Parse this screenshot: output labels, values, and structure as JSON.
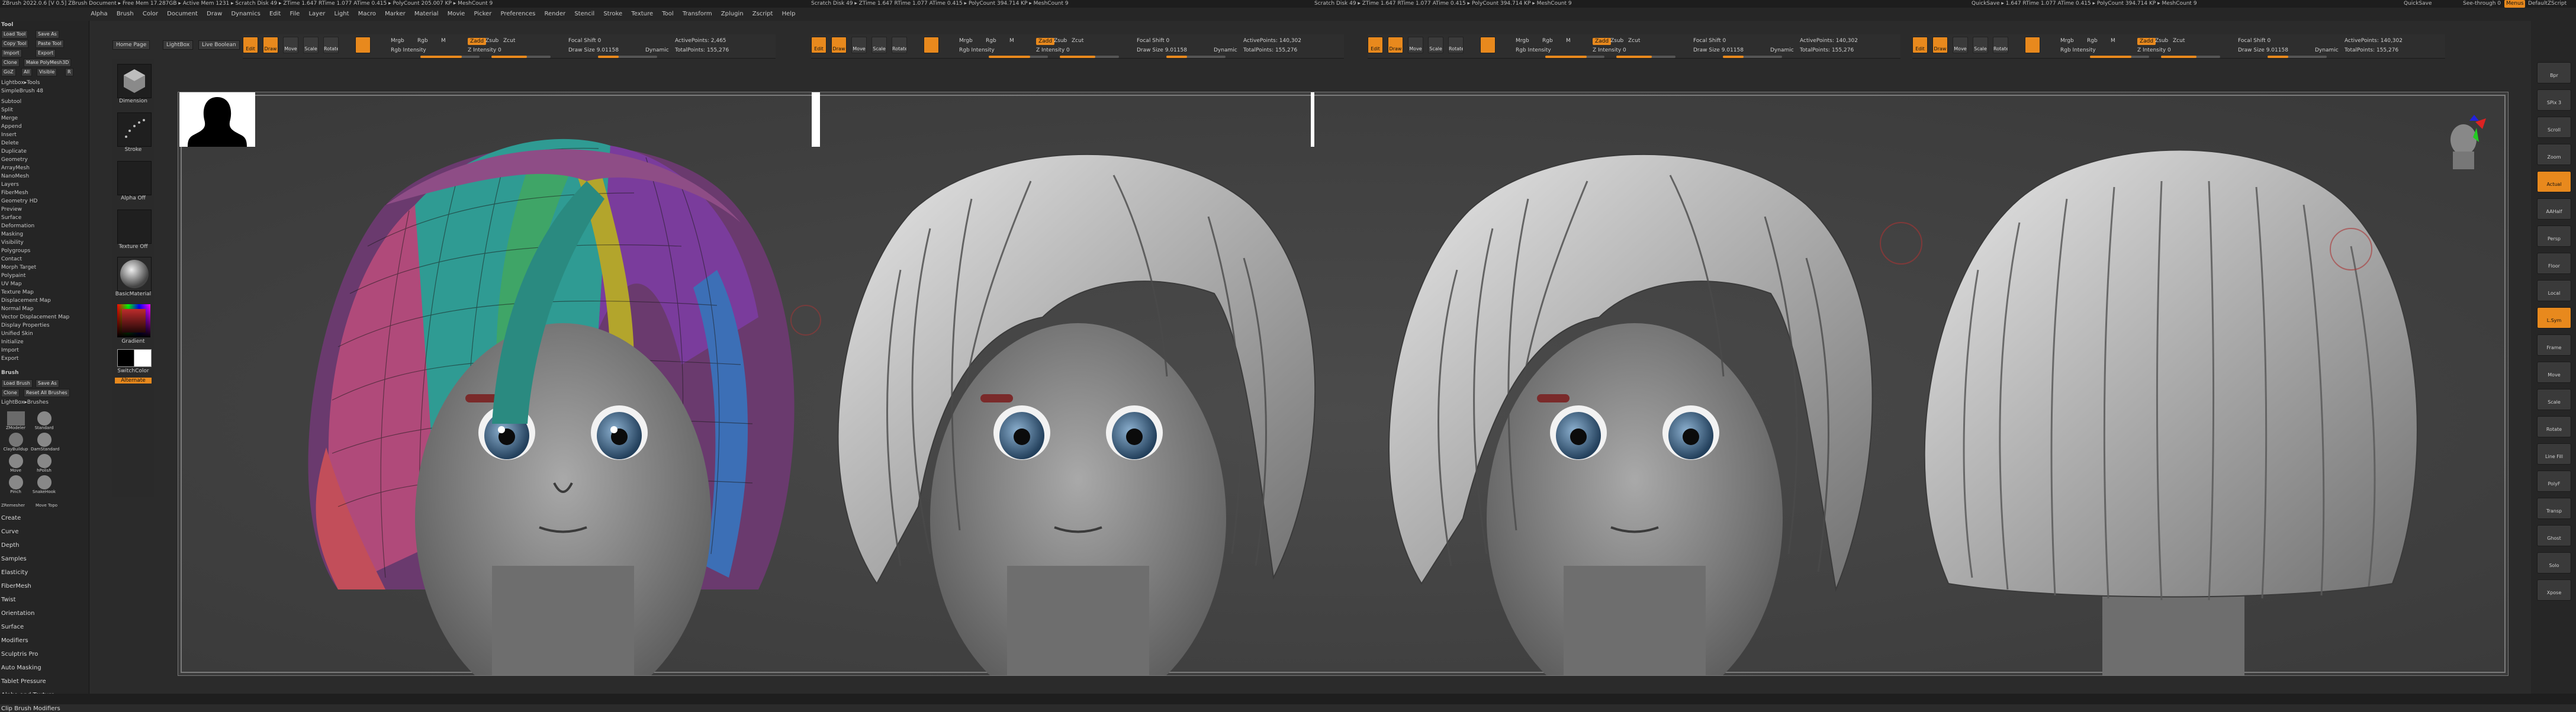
{
  "app": {
    "title_segments": [
      "ZBrush 2022.0.6 [V 0.5]   ZBrush Document   ▸ Free Mem 17.287GB ▸ Active Mem 1231 ▸ Scratch Disk 49 ▸ ZTime 1.647 RTime 1.077 ATime 0.415 ▸ PolyCount 205.007 KP ▸ MeshCount 9",
      "Scratch Disk 49 ▸ ZTime 1.647 RTime 1.077 ATime 0.415 ▸ PolyCount 394.714 KP ▸ MeshCount 9",
      "Scratch Disk 49 ▸ ZTime 1.647 RTime 1.077 ATime 0.415 ▸ PolyCount 394.714 KP ▸ MeshCount 9",
      "QuickSave ▸ 1.647 RTime 1.077 ATime 0.415 ▸ PolyCount 394.714 KP ▸ MeshCount 9"
    ],
    "right_title": [
      "QuickSave",
      "See-through 0",
      "Menus",
      "DefaultZScript"
    ]
  },
  "menus": [
    "Alpha",
    "Brush",
    "Color",
    "Document",
    "Draw",
    "Dynamics",
    "Edit",
    "File",
    "Layer",
    "Light",
    "Macro",
    "Marker",
    "Material",
    "Movie",
    "Picker",
    "Preferences",
    "Render",
    "Stencil",
    "Stroke",
    "Texture",
    "Tool",
    "Transform",
    "Zplugin",
    "Zscript",
    "Help"
  ],
  "toolbar": {
    "buttons": [
      "Edit",
      "Draw",
      "Move",
      "Scale",
      "Rotate"
    ],
    "mrgb": "Mrgb",
    "rgb": "Rgb",
    "m": "M",
    "zadd": "Zadd",
    "zsub": "Zsub",
    "zcut": "Zcut",
    "rgb_intensity": "Rgb Intensity",
    "z_intensity": "Z Intensity 0",
    "focal_shift": "Focal Shift 0",
    "draw_size": "Draw Size 9.01158",
    "dynamic": "Dynamic",
    "active_points": "ActivePoints: 2,465",
    "total_points": "TotalPoints: 155,276",
    "active_points_b": "ActivePoints: 140,302",
    "total_points_b": "TotalPoints: 155,276"
  },
  "left_palette": {
    "title": "Tool",
    "rows": [
      "Load Tool",
      "Save As",
      "Copy Tool",
      "Paste Tool",
      "Import",
      "Export",
      "Clone",
      "Make PolyMesh3D",
      "GoZ",
      "All",
      "Visible",
      "R",
      "Lightbox▸Tools",
      "SimpleBrush 48",
      "Subtool",
      "Split",
      "Merge",
      "Append",
      "Insert",
      "Delete",
      "Duplicate",
      "Geometry",
      "ArrayMesh",
      "NanoMesh",
      "Layers",
      "FiberMesh",
      "Geometry HD",
      "Preview",
      "Surface",
      "Deformation",
      "Masking",
      "Visibility",
      "Polygroups",
      "Contact",
      "Morph Target",
      "Polypaint",
      "UV Map",
      "Texture Map",
      "Displacement Map",
      "Normal Map",
      "Vector Displacement Map",
      "Display Properties",
      "Unified Skin",
      "Initialize",
      "Import",
      "Export"
    ],
    "brush_title": "Brush",
    "brush_buttons": [
      "Load Brush",
      "Save As",
      "Clone",
      "Reset All Brushes",
      "LightBox▸Brushes"
    ],
    "brush_tiles": [
      "ZModeler",
      "Standard",
      "ClayBuildup",
      "DamStandard",
      "Move",
      "hPolish",
      "Pinch",
      "SnakeHook",
      "ZRemesher",
      "Move Topo"
    ],
    "bottom_menus": [
      "Create",
      "Curve",
      "Depth",
      "Samples",
      "Elasticity",
      "FiberMesh",
      "Twist",
      "Orientation",
      "Surface",
      "Modifiers",
      "Sculptris Pro",
      "Auto Masking",
      "Tablet Pressure",
      "Alpha and Texture",
      "Clip Brush Modifiers"
    ]
  },
  "shelf": {
    "home_page": "Home Page",
    "lightbox": "LightBox",
    "live_boolean": "Live Boolean",
    "items": [
      "Dimension",
      "Stroke",
      "Alpha Off",
      "Texture Off",
      "BasicMaterial",
      "Gradient",
      "SwitchColor",
      "Alternate"
    ]
  },
  "right_shelf": [
    "Bpr",
    "SPix 3",
    "Scroll",
    "Zoom",
    "Actual",
    "AAHalf",
    "Persp",
    "Floor",
    "Local",
    "L.Sym",
    "Frame",
    "Move",
    "Scale",
    "Rotate",
    "Line Fill",
    "PolyF",
    "Transp",
    "Ghost",
    "Solo",
    "Xpose"
  ],
  "bottom_bar": "",
  "colors": {
    "accent": "#e8891d",
    "bg": "#2b2b2b",
    "canvas": "#454545"
  }
}
